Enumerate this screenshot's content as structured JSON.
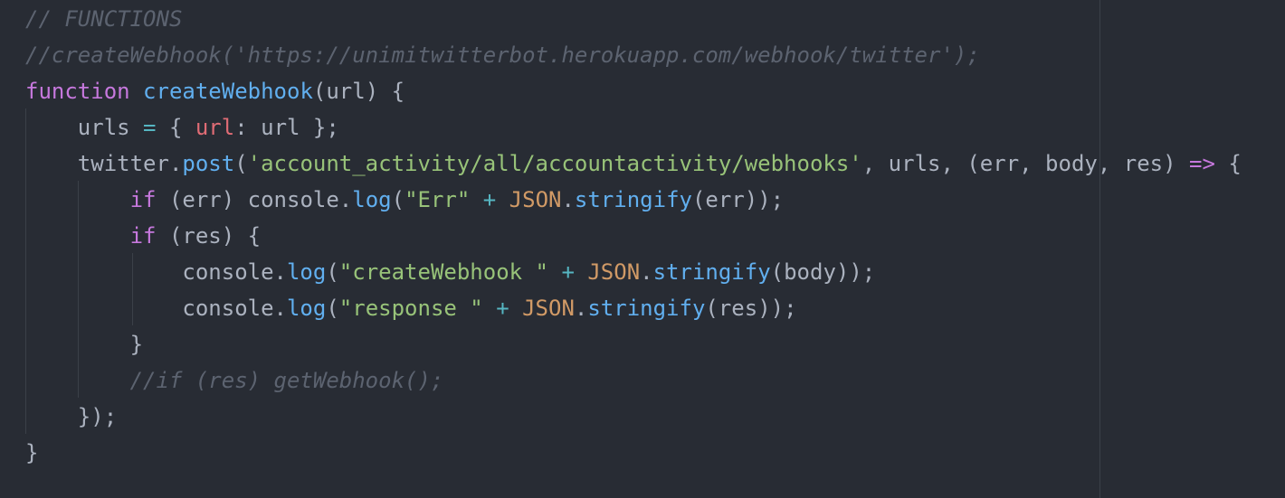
{
  "editor": {
    "theme_colors": {
      "background": "#282c34",
      "comment": "#5c6370",
      "keyword": "#c678dd",
      "function": "#61afef",
      "string": "#98c379",
      "operator": "#56b6c2",
      "constant": "#d19a66",
      "property": "#e06c75",
      "plain": "#abb2bf"
    },
    "lines": [
      [
        {
          "t": "c",
          "v": "// FUNCTIONS"
        }
      ],
      [
        {
          "t": "c",
          "v": "//createWebhook('https://unimitwitterbot.herokuapp.com/webhook/twitter');"
        }
      ],
      [
        {
          "t": "k",
          "v": "function"
        },
        {
          "t": "p",
          "v": " "
        },
        {
          "t": "f",
          "v": "createWebhook"
        },
        {
          "t": "p",
          "v": "(url) {"
        }
      ],
      [
        {
          "t": "p",
          "v": "    urls "
        },
        {
          "t": "o",
          "v": "="
        },
        {
          "t": "p",
          "v": " { "
        },
        {
          "t": "r",
          "v": "url"
        },
        {
          "t": "p",
          "v": ": url };"
        }
      ],
      [
        {
          "t": "p",
          "v": "    twitter."
        },
        {
          "t": "f",
          "v": "post"
        },
        {
          "t": "p",
          "v": "("
        },
        {
          "t": "s",
          "v": "'account_activity/all/accountactivity/webhooks'"
        },
        {
          "t": "p",
          "v": ", urls, (err, body, res) "
        },
        {
          "t": "k",
          "v": "=>"
        },
        {
          "t": "p",
          "v": " {"
        }
      ],
      [
        {
          "t": "p",
          "v": "        "
        },
        {
          "t": "k",
          "v": "if"
        },
        {
          "t": "p",
          "v": " (err) console."
        },
        {
          "t": "f",
          "v": "log"
        },
        {
          "t": "p",
          "v": "("
        },
        {
          "t": "s",
          "v": "\"Err\""
        },
        {
          "t": "p",
          "v": " "
        },
        {
          "t": "o",
          "v": "+"
        },
        {
          "t": "p",
          "v": " "
        },
        {
          "t": "n",
          "v": "JSON"
        },
        {
          "t": "p",
          "v": "."
        },
        {
          "t": "f",
          "v": "stringify"
        },
        {
          "t": "p",
          "v": "(err));"
        }
      ],
      [
        {
          "t": "p",
          "v": "        "
        },
        {
          "t": "k",
          "v": "if"
        },
        {
          "t": "p",
          "v": " (res) {"
        }
      ],
      [
        {
          "t": "p",
          "v": "            console."
        },
        {
          "t": "f",
          "v": "log"
        },
        {
          "t": "p",
          "v": "("
        },
        {
          "t": "s",
          "v": "\"createWebhook \""
        },
        {
          "t": "p",
          "v": " "
        },
        {
          "t": "o",
          "v": "+"
        },
        {
          "t": "p",
          "v": " "
        },
        {
          "t": "n",
          "v": "JSON"
        },
        {
          "t": "p",
          "v": "."
        },
        {
          "t": "f",
          "v": "stringify"
        },
        {
          "t": "p",
          "v": "(body));"
        }
      ],
      [
        {
          "t": "p",
          "v": "            console."
        },
        {
          "t": "f",
          "v": "log"
        },
        {
          "t": "p",
          "v": "("
        },
        {
          "t": "s",
          "v": "\"response \""
        },
        {
          "t": "p",
          "v": " "
        },
        {
          "t": "o",
          "v": "+"
        },
        {
          "t": "p",
          "v": " "
        },
        {
          "t": "n",
          "v": "JSON"
        },
        {
          "t": "p",
          "v": "."
        },
        {
          "t": "f",
          "v": "stringify"
        },
        {
          "t": "p",
          "v": "(res));"
        }
      ],
      [
        {
          "t": "p",
          "v": "        }"
        }
      ],
      [
        {
          "t": "p",
          "v": "        "
        },
        {
          "t": "c",
          "v": "//if (res) getWebhook();"
        }
      ],
      [
        {
          "t": "p",
          "v": "    });"
        }
      ],
      [
        {
          "t": "p",
          "v": "}"
        }
      ]
    ]
  }
}
